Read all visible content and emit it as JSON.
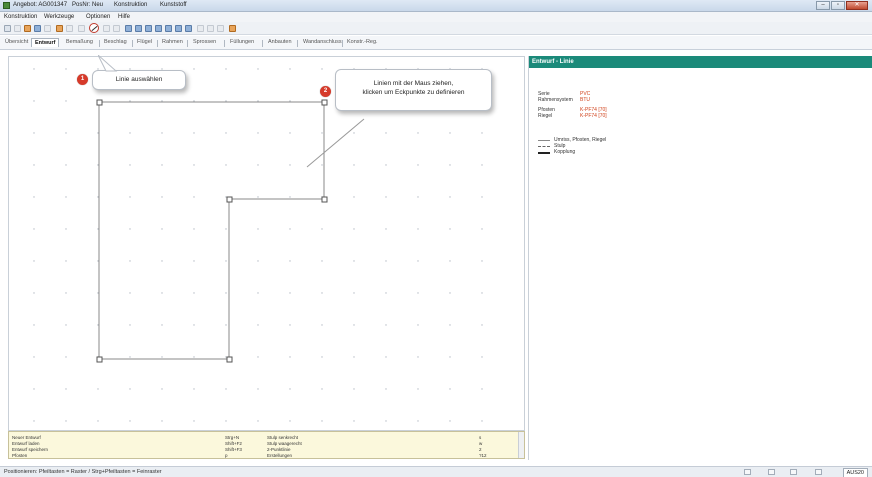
{
  "window": {
    "title_parts": [
      "Angebot: AG001347",
      "PosNr: Neu",
      "Konstruktion",
      "Kunststoff"
    ]
  },
  "menu": [
    "Konstruktion",
    "Werkzeuge",
    "Optionen",
    "Hilfe"
  ],
  "tabs": [
    "Übersicht",
    "Entwurf",
    "Bemaßung",
    "Beschlag",
    "Flügel",
    "Rahmen",
    "Sprossen",
    "Füllungen",
    "Anbauten",
    "Wandanschluss",
    "Konstr.-Reg."
  ],
  "active_tab": "Entwurf",
  "callouts": {
    "step1_number": "1",
    "step1_text": "Linie auswählen",
    "step2_number": "2",
    "step2_line1": "Linien mit der Maus ziehen,",
    "step2_line2": "klicken um Eckpunkte zu definieren"
  },
  "right_panel": {
    "header": "Entwurf - Linie",
    "rows": [
      {
        "label": "Serie",
        "value": "PVC"
      },
      {
        "label": "Rahmensystem",
        "value": "BTU"
      },
      {
        "label": "Pfosten",
        "value": "K-PF74 [70]"
      },
      {
        "label": "Riegel",
        "value": "K-PF74 [70]"
      }
    ],
    "legend": [
      "Umriss, Pfosten, Riegel",
      "Stulp",
      "Kopplung"
    ]
  },
  "info_box": {
    "col1": [
      "Neuer Entwurf",
      "Entwurf laden",
      "Entwurf speichern",
      "Pfosten"
    ],
    "col2": [
      "Strg+N",
      "Shift+F2",
      "Shift+F3",
      "p"
    ],
    "col3": [
      "Stulp senkrecht",
      "Stulp waagerecht",
      "2-Punktlinie",
      "Erstellungen"
    ],
    "col4": [
      "s",
      "w",
      "2",
      "?12"
    ]
  },
  "status": {
    "text": "Positionieren: Pfeiltasten = Raster / Strg+Pfeiltasten = Feinraster",
    "user": "AUS20"
  },
  "colors": {
    "accent_teal": "#1b8a7a",
    "badge_red": "#d63a2a",
    "value_red": "#d0421b"
  }
}
